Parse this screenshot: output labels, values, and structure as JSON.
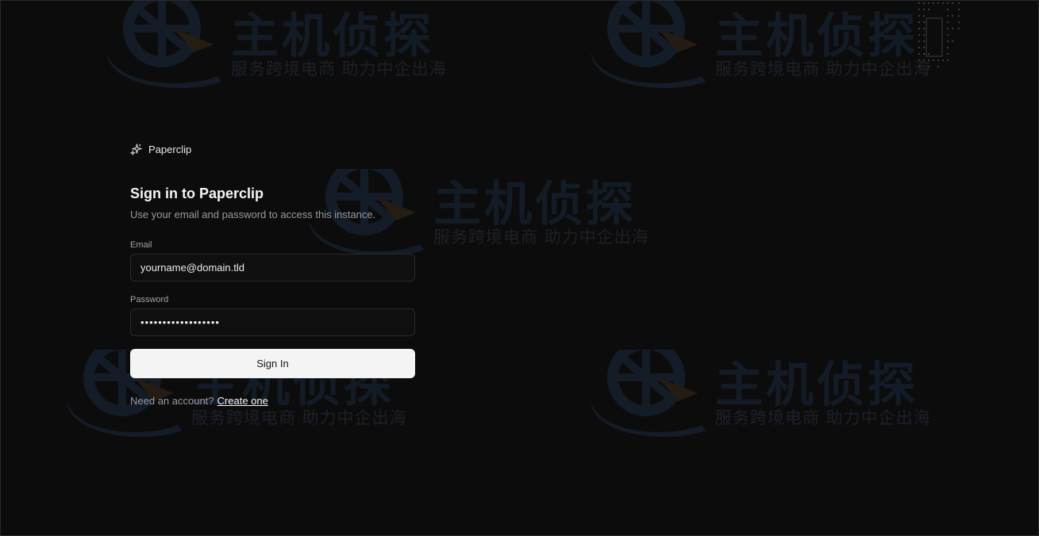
{
  "brand": {
    "name": "Paperclip",
    "icon": "sparkles-icon"
  },
  "form": {
    "heading": "Sign in to Paperclip",
    "subheading": "Use your email and password to access this instance.",
    "email_label": "Email",
    "email_value": "yourname@domain.tld",
    "password_label": "Password",
    "password_value": "••••••••••••••••••",
    "submit_label": "Sign In",
    "signup_prompt": "Need an account?",
    "signup_link": "Create one"
  },
  "watermark": {
    "title": "主机侦探",
    "subtitle": "服务跨境电商 助力中企出海"
  },
  "colors": {
    "background": "#0c0c0c",
    "button_bg": "#f4f4f5",
    "input_border": "#2b2b2e"
  }
}
